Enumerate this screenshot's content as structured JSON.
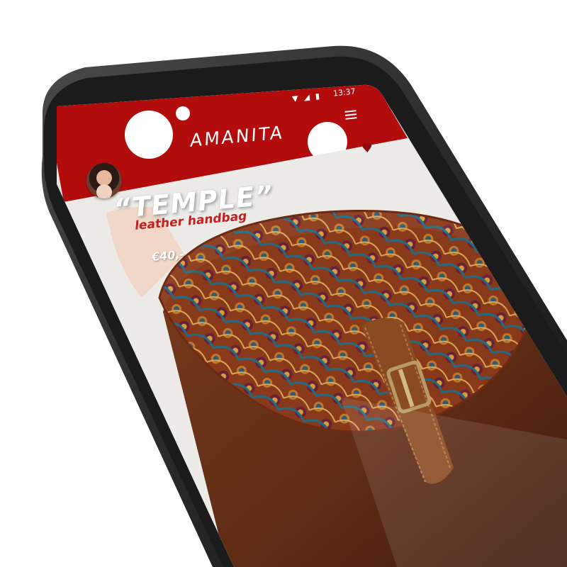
{
  "status_bar": {
    "time": "13:37",
    "icons": [
      "wifi-icon",
      "signal-icon",
      "battery-icon"
    ]
  },
  "app_bar": {
    "title": "AMANITA",
    "menu_icon": "menu-icon",
    "background_color": "#b30c0c"
  },
  "profile": {
    "avatar_icon": "avatar"
  },
  "favorite": {
    "icon": "heart-icon",
    "color": "#8e0e0e"
  },
  "product": {
    "name": "“TEMPLE”",
    "subtitle": "leather handbag",
    "price": "€40,-",
    "accent_color": "#c0201e"
  }
}
